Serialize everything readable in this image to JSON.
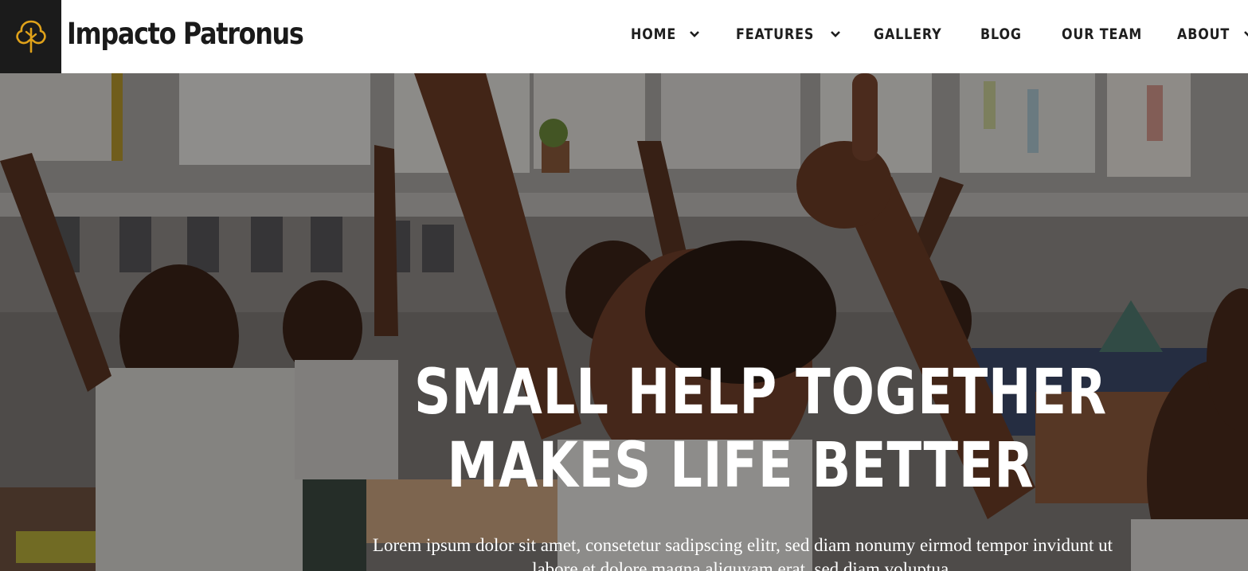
{
  "header": {
    "brand": "Impacto Patronus",
    "logo_icon": "tree-icon",
    "colors": {
      "logo_bg": "#1b1b1b",
      "logo_accent": "#e0a21a",
      "text": "#1e1e1e"
    },
    "nav": [
      {
        "label": "HOME",
        "has_dropdown": true
      },
      {
        "label": "FEATURES",
        "has_dropdown": true
      },
      {
        "label": "GALLERY",
        "has_dropdown": false
      },
      {
        "label": "BLOG",
        "has_dropdown": false
      },
      {
        "label": "OUR TEAM",
        "has_dropdown": false
      },
      {
        "label": "ABOUT",
        "has_dropdown": true
      }
    ]
  },
  "hero": {
    "headline_line1": "SMALL HELP TOGETHER",
    "headline_line2": "MAKES LIFE BETTER",
    "lead": "Lorem ipsum dolor sit amet, consetetur sadipscing elitr, sed diam nonumy eirmod tempor invidunt ut labore et dolore magna aliquyam erat, sed diam voluptua."
  }
}
